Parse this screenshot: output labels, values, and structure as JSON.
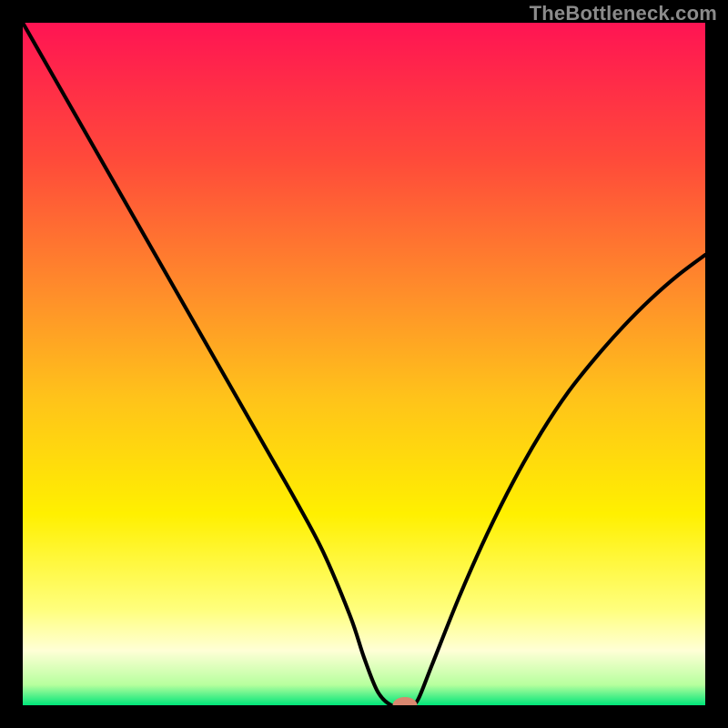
{
  "watermark": "TheBottleneck.com",
  "chart_data": {
    "type": "line",
    "title": "",
    "xlabel": "",
    "ylabel": "",
    "xlim": [
      0,
      100
    ],
    "ylim": [
      0,
      100
    ],
    "grid": false,
    "legend": false,
    "background": {
      "type": "vertical-gradient",
      "stops": [
        {
          "pos": 0.0,
          "color": "#ff1453"
        },
        {
          "pos": 0.2,
          "color": "#ff4a3a"
        },
        {
          "pos": 0.4,
          "color": "#ff8f2a"
        },
        {
          "pos": 0.55,
          "color": "#ffc31a"
        },
        {
          "pos": 0.72,
          "color": "#fff000"
        },
        {
          "pos": 0.86,
          "color": "#ffff7d"
        },
        {
          "pos": 0.92,
          "color": "#ffffd6"
        },
        {
          "pos": 0.97,
          "color": "#b7ff9e"
        },
        {
          "pos": 1.0,
          "color": "#00e579"
        }
      ]
    },
    "series": [
      {
        "name": "bottleneck-curve",
        "color": "#000000",
        "x": [
          0,
          4,
          8,
          12,
          16,
          20,
          24,
          28,
          32,
          36,
          40,
          44,
          48,
          50,
          52,
          54,
          56,
          57,
          58,
          60,
          64,
          68,
          72,
          76,
          80,
          84,
          88,
          92,
          96,
          100
        ],
        "y": [
          100,
          93,
          86,
          79,
          72,
          65,
          58,
          51,
          44,
          37,
          30,
          22.5,
          13,
          7,
          2,
          0,
          0,
          0,
          1,
          6,
          16,
          25,
          33,
          40,
          46,
          51,
          55.5,
          59.5,
          63,
          66
        ]
      }
    ],
    "marker": {
      "x": 56,
      "y": 0,
      "color": "#d9876f",
      "rx": 1.8,
      "ry": 1.2
    }
  }
}
